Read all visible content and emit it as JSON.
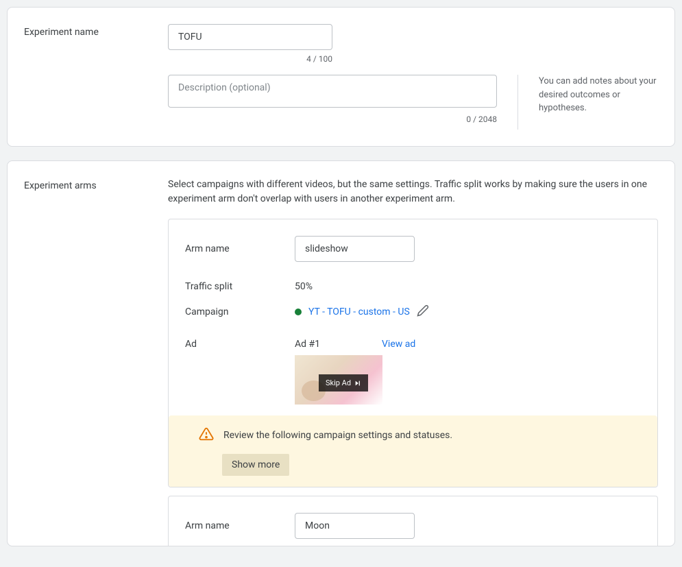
{
  "experiment": {
    "name_label": "Experiment name",
    "name_value": "TOFU",
    "name_counter": "4 / 100",
    "description_placeholder": "Description (optional)",
    "description_value": "",
    "description_counter": "0 / 2048",
    "description_help": "You can add notes about your desired outcomes or hypotheses."
  },
  "arms_section": {
    "label": "Experiment arms",
    "description": "Select campaigns with different videos, but the same settings. Traffic split works by making sure the users in one experiment arm don't overlap with users in another experiment arm."
  },
  "arm1": {
    "name_label": "Arm name",
    "name_value": "slideshow",
    "traffic_label": "Traffic split",
    "traffic_value": "50%",
    "campaign_label": "Campaign",
    "campaign_link": "YT - TOFU - custom - US",
    "ad_label": "Ad",
    "ad_number": "Ad #1",
    "view_ad": "View ad",
    "skip_text": "Skip Ad",
    "alert_text": "Review the following campaign settings and statuses.",
    "show_more": "Show more"
  },
  "arm2": {
    "name_label": "Arm name",
    "name_value": "Moon"
  }
}
